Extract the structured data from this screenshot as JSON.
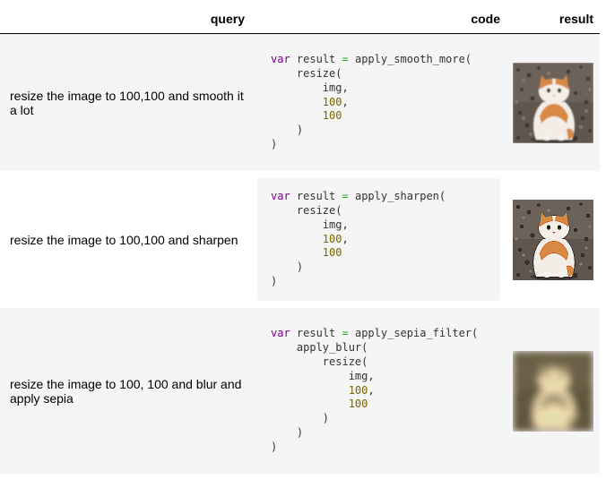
{
  "header": {
    "query": "query",
    "code": "code",
    "result": "result"
  },
  "rows": [
    {
      "query": "resize the image to 100,100 and smooth it a lot",
      "code": {
        "var": "var",
        "name": "result",
        "op": "=",
        "outer_fn": "apply_smooth_more(",
        "inner_fn": "resize(",
        "arg": "img,",
        "width": "100",
        "height": "100",
        "close": ")"
      },
      "result_image": "cat-smoothed-thumbnail"
    },
    {
      "query": "resize the image to 100,100 and sharpen",
      "code": {
        "var": "var",
        "name": "result",
        "op": "=",
        "outer_fn": "apply_sharpen(",
        "inner_fn": "resize(",
        "arg": "img,",
        "width": "100",
        "height": "100",
        "close": ")"
      },
      "result_image": "cat-sharpened-thumbnail"
    },
    {
      "query": "resize the image to 100, 100 and blur and apply sepia",
      "code": {
        "var": "var",
        "name": "result",
        "op": "=",
        "outer_fn": "apply_sepia_filter(",
        "middle_fn": "apply_blur(",
        "inner_fn": "resize(",
        "arg": "img,",
        "width": "100",
        "height": "100",
        "close": ")"
      },
      "result_image": "cat-blurred-sepia-thumbnail"
    }
  ],
  "colors": {
    "keyword": "#770088",
    "operator": "#22aa22",
    "number": "#776600",
    "code_text": "#333333",
    "stripe": "#f5f5f5"
  }
}
